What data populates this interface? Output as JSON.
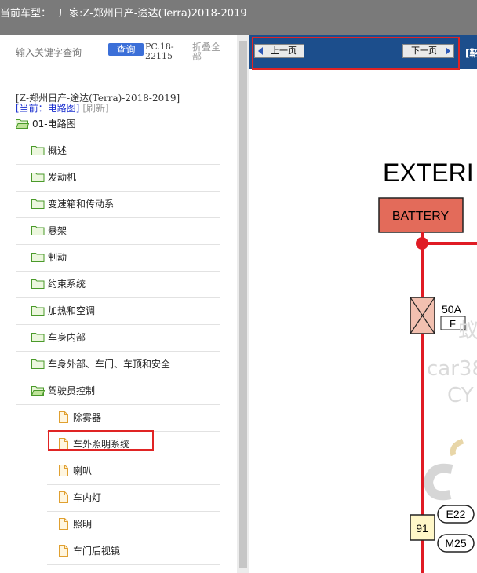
{
  "header": {
    "vehicle_label": "当前车型：",
    "vehicle_value": "厂家:Z-郑州日产-途达(Terra)2018-2019",
    "dot": "."
  },
  "search": {
    "placeholder": "输入关键字查询",
    "button_label": "查询",
    "code": "PC.18-22115",
    "collapse_label": "折叠全部"
  },
  "context": {
    "title": "[Z-郑州日产-途达(Terra)-2018-2019]",
    "current_label": "[当前：电路图]",
    "refresh_label": "[刷新]"
  },
  "tree": {
    "root": "01-电路图",
    "folders": [
      "概述",
      "发动机",
      "变速箱和传动系",
      "悬架",
      "制动",
      "约束系统",
      "加热和空调",
      "车身内部",
      "车身外部、车门、车顶和安全",
      "驾驶员控制"
    ],
    "docs": [
      "除雾器",
      "车外照明系统",
      "喇叭",
      "车内灯",
      "照明",
      "车门后视镜"
    ]
  },
  "nav": {
    "prev_label": "上一页",
    "next_label": "下一页",
    "extra_label": "[鞀"
  },
  "diagram": {
    "title": "EXTERI",
    "battery_label": "BATTERY",
    "fuse_rating": "50A",
    "fuse_code": "F",
    "junction_number": "91",
    "connector_1": "E22",
    "connector_2": "M25",
    "watermark_1": "car38",
    "watermark_2": "CY",
    "watermark_3": "蚁",
    "wire_color": "#e01b24"
  }
}
